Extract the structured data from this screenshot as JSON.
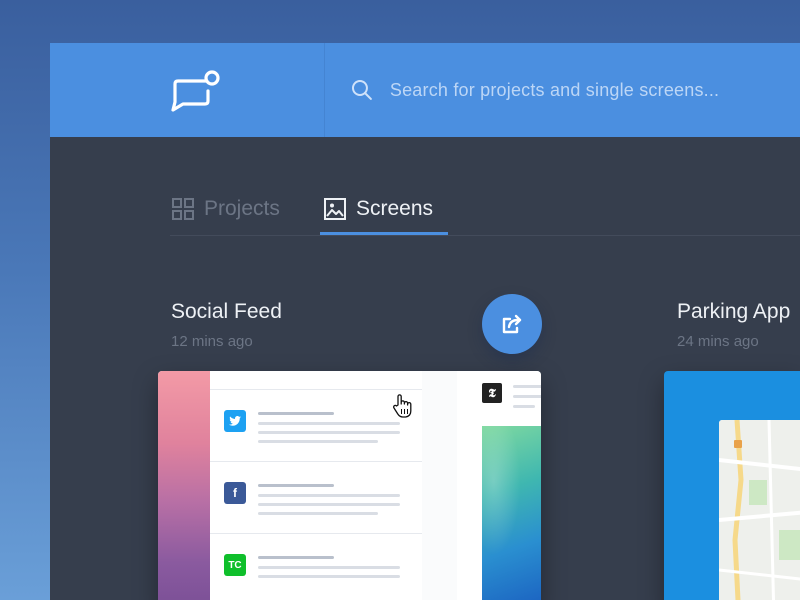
{
  "search": {
    "placeholder": "Search for projects and single screens..."
  },
  "tabs": [
    {
      "label": "Projects",
      "active": false,
      "icon": "grid-icon"
    },
    {
      "label": "Screens",
      "active": true,
      "icon": "image-icon"
    }
  ],
  "cards": [
    {
      "title": "Social Feed",
      "time": "12 mins ago",
      "feed_icons": [
        "twitter-icon",
        "facebook-icon",
        "techcrunch-icon"
      ]
    },
    {
      "title": "Parking App",
      "time": "24 mins ago"
    }
  ],
  "feed_icon_text": {
    "twitter": "🐦",
    "facebook": "f",
    "techcrunch": "TC",
    "nyt": "𝕿"
  },
  "colors": {
    "accent": "#4b8fe0",
    "panel": "#363e4d",
    "twitter": "#1da1f2",
    "facebook": "#3b5998",
    "techcrunch": "#0fbf2b"
  }
}
